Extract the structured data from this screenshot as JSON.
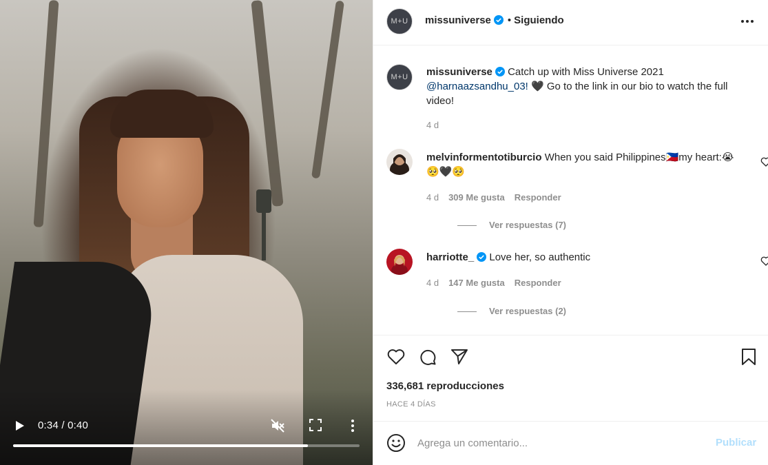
{
  "video": {
    "time_display": "0:34 / 0:40",
    "progress_fraction": 0.85,
    "icons": [
      "play-icon",
      "mute-icon",
      "fullscreen-icon",
      "more-vertical-icon"
    ]
  },
  "header": {
    "avatar_text": "M+U",
    "username": "missuniverse",
    "separator": "•",
    "follow_state": "Siguiendo"
  },
  "caption": {
    "avatar_text": "M+U",
    "username": "missuniverse",
    "text_before": "Catch up with Miss Universe 2021",
    "mention": "@harnaazsandhu_03!",
    "text_after": "🖤 Go to the link in our bio to watch the full video!",
    "time": "4 d"
  },
  "comments": [
    {
      "username": "melvinformentotiburcio",
      "text": "When you said Philippines🇵🇭my heart:😭🥺🖤🥺",
      "time": "4 d",
      "likes": "309 Me gusta",
      "reply_label": "Responder",
      "view_replies": "Ver respuestas (7)",
      "verified": false
    },
    {
      "username": "harriotte_",
      "text": "Love her, so authentic",
      "time": "4 d",
      "likes": "147 Me gusta",
      "reply_label": "Responder",
      "view_replies": "Ver respuestas (2)",
      "verified": true
    }
  ],
  "stats": {
    "views": "336,681 reproducciones",
    "posted": "HACE 4 DÍAS"
  },
  "comment_box": {
    "placeholder": "Agrega un comentario...",
    "publish_label": "Publicar"
  },
  "colors": {
    "verified_blue": "#0095f6",
    "publish_disabled": "#b2dffc",
    "muted_text": "#8e8e8e",
    "border": "#efefef"
  }
}
